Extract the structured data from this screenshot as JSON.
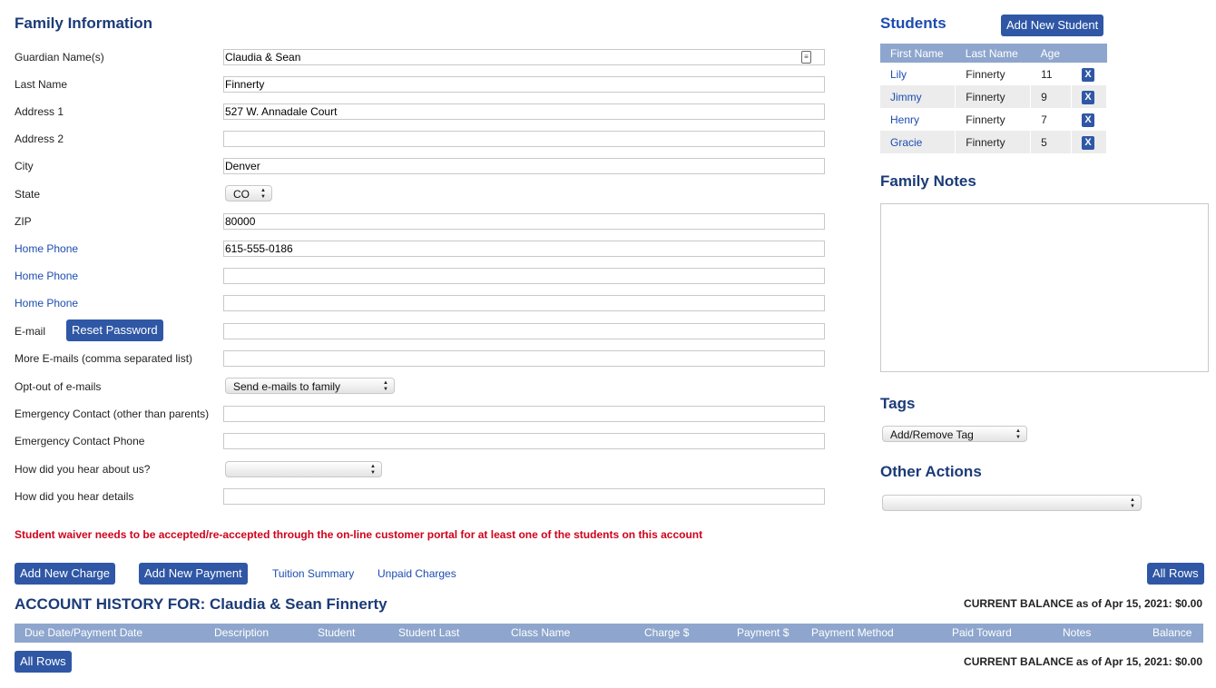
{
  "family": {
    "title": "Family Information",
    "fields": [
      {
        "label": "Guardian Name(s)",
        "value": "Claudia & Sean",
        "link": false
      },
      {
        "label": "Last Name",
        "value": "Finnerty",
        "link": false
      },
      {
        "label": "Address 1",
        "value": "527 W. Annadale Court",
        "link": false
      },
      {
        "label": "Address 2",
        "value": "",
        "link": false
      },
      {
        "label": "City",
        "value": "Denver",
        "link": false
      },
      {
        "label": "State",
        "value": "CO",
        "link": false
      },
      {
        "label": "ZIP",
        "value": "80000",
        "link": false
      },
      {
        "label": "Home Phone",
        "value": "615-555-0186",
        "link": true
      },
      {
        "label": "Home Phone",
        "value": "",
        "link": true
      },
      {
        "label": "Home Phone",
        "value": "",
        "link": true
      },
      {
        "label": "E-mail",
        "value": "",
        "link": false
      },
      {
        "label": "More E-mails (comma separated list)",
        "value": "",
        "link": false
      },
      {
        "label": "Opt-out of e-mails",
        "value": "Send e-mails to family",
        "link": false
      },
      {
        "label": "Emergency Contact (other than parents)",
        "value": "",
        "link": false
      },
      {
        "label": "Emergency Contact Phone",
        "value": "",
        "link": false
      },
      {
        "label": "How did you hear about us?",
        "value": "",
        "link": false
      },
      {
        "label": "How did you hear details",
        "value": "",
        "link": false
      }
    ],
    "reset_password": "Reset Password"
  },
  "waiver_warning": "Student waiver needs to be accepted/re-accepted through the on-line customer portal for at least one of the students on this account",
  "students": {
    "title": "Students",
    "add_button": "Add New Student",
    "headers": [
      "First Name",
      "Last Name",
      "Age"
    ],
    "rows": [
      {
        "first": "Lily",
        "last": "Finnerty",
        "age": "11"
      },
      {
        "first": "Jimmy",
        "last": "Finnerty",
        "age": "9"
      },
      {
        "first": "Henry",
        "last": "Finnerty",
        "age": "7"
      },
      {
        "first": "Gracie",
        "last": "Finnerty",
        "age": "5"
      }
    ],
    "remove_label": "X"
  },
  "notes": {
    "title": "Family Notes",
    "value": ""
  },
  "tags": {
    "title": "Tags",
    "select": "Add/Remove Tag"
  },
  "other_actions": {
    "title": "Other Actions",
    "select": ""
  },
  "actions": {
    "add_charge": "Add New Charge",
    "add_payment": "Add New Payment",
    "tuition_summary": "Tuition Summary",
    "unpaid_charges": "Unpaid Charges",
    "all_rows": "All Rows"
  },
  "history": {
    "title": "ACCOUNT HISTORY FOR: Claudia & Sean Finnerty",
    "balance": "CURRENT BALANCE as of Apr 15, 2021: $0.00",
    "columns": [
      "Due Date/Payment Date",
      "Description",
      "Student",
      "Student Last",
      "Class Name",
      "Charge $",
      "Payment $",
      "Payment Method",
      "Paid Toward",
      "Notes",
      "Balance"
    ],
    "header_color": "#8ea6cd"
  },
  "colors": {
    "accent": "#2f57a5",
    "heading": "#1b3b77",
    "link": "#1c4cb0",
    "warning": "#d0021b"
  }
}
